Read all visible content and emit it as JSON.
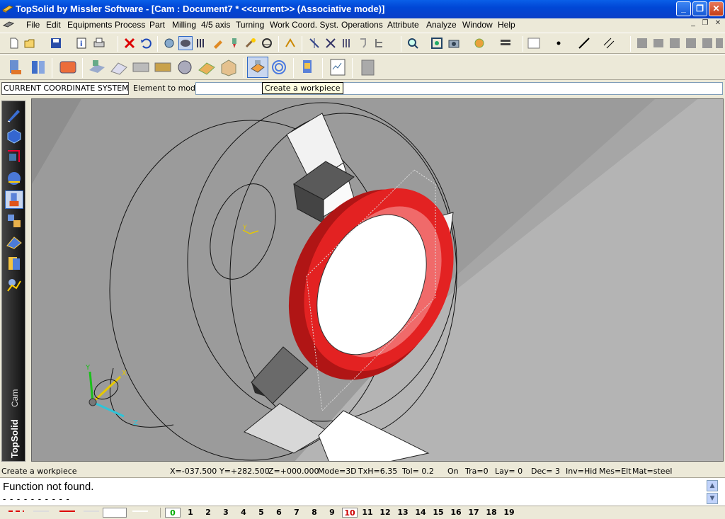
{
  "window": {
    "title": "TopSolid by Missler Software - [Cam : Document7 *  <<current>> (Associative mode)]",
    "minimize": "_",
    "maximize": "❐",
    "close": "✕"
  },
  "menu": {
    "items": [
      "File",
      "Edit",
      "Equipments",
      "Process",
      "Part",
      "Milling",
      "4/5 axis",
      "Turning",
      "Work Coord. Syst.",
      "Operations",
      "Attribute",
      "Analyze",
      "Window",
      "Help"
    ],
    "mdi_minimize": "_",
    "mdi_restore": "❐",
    "mdi_close": "✕"
  },
  "toolbar1": {
    "icons": [
      "new-icon",
      "open-icon",
      "save-icon",
      "properties-icon",
      "print-icon",
      "delete-icon",
      "undo-icon",
      "refresh-icon",
      "shade-icon",
      "coordinate-icon",
      "tool-icon",
      "drill-icon",
      "simulate-icon",
      "dim-icon",
      "curve-icon",
      "section-icon",
      "edit-icon",
      "measure-icon",
      "zoom-icon",
      "zoom-fit-icon",
      "camera-icon",
      "render-icon",
      "layer-icon",
      "color-swatch-icon",
      "point-style-icon",
      "line-style-icon",
      "hatch-icon"
    ]
  },
  "toolbar2": {
    "icons": [
      "machine-icon",
      "workshop-icon",
      "stock-icon",
      "part-icon",
      "fixture-icon",
      "holder-icon",
      "clamp-icon",
      "vise-icon",
      "pallet-icon",
      "block-icon",
      "workpiece-icon",
      "target-icon",
      "operator-icon",
      "report-icon",
      "document-icon"
    ]
  },
  "context": {
    "coordinate_system": "CURRENT COORDINATE SYSTEM",
    "element_label": "Element to modify:",
    "element_value": "",
    "tooltip": "Create a workpiece"
  },
  "left_toolbar": {
    "icons": [
      "sketch-icon",
      "shape-icon",
      "design-icon",
      "draft-icon",
      "cam-icon",
      "assembly-icon",
      "family-icon",
      "unfold-icon",
      "analysis-icon"
    ],
    "selected": "cam-icon",
    "brand": "TopSolid",
    "module": "Cam"
  },
  "viewport": {
    "axis_labels": {
      "x": "X",
      "y": "Y",
      "z": "Z"
    },
    "local_axis_labels": {
      "x": "X",
      "y": "Y"
    },
    "colors": {
      "background": "#9b9b9b",
      "ring": "#e32222",
      "floor": "#b6b6b6"
    }
  },
  "status": {
    "message": "Create a workpiece",
    "x": "X=-037.500",
    "y": "Y=+282.500",
    "z": "Z=+000.000",
    "mode": "Mode=3D",
    "txh": "TxH=6.35",
    "tol": "Tol=   0.2",
    "on": "On",
    "tra": "Tra=0",
    "lay": "Lay=   0",
    "dec": "Dec= 3",
    "inv": "Inv=Hid",
    "mes": "Mes=Elt",
    "mat": "Mat=steel"
  },
  "console": {
    "line1": "Function not found.",
    "line2": "- - - - - - - - - -",
    "scroll_up": "▲",
    "scroll_down": "▼"
  },
  "layers": {
    "items": [
      "0",
      "1",
      "2",
      "3",
      "4",
      "5",
      "6",
      "7",
      "8",
      "9",
      "10",
      "11",
      "12",
      "13",
      "14",
      "15",
      "16",
      "17",
      "18",
      "19"
    ],
    "current": "0",
    "active": "10"
  }
}
